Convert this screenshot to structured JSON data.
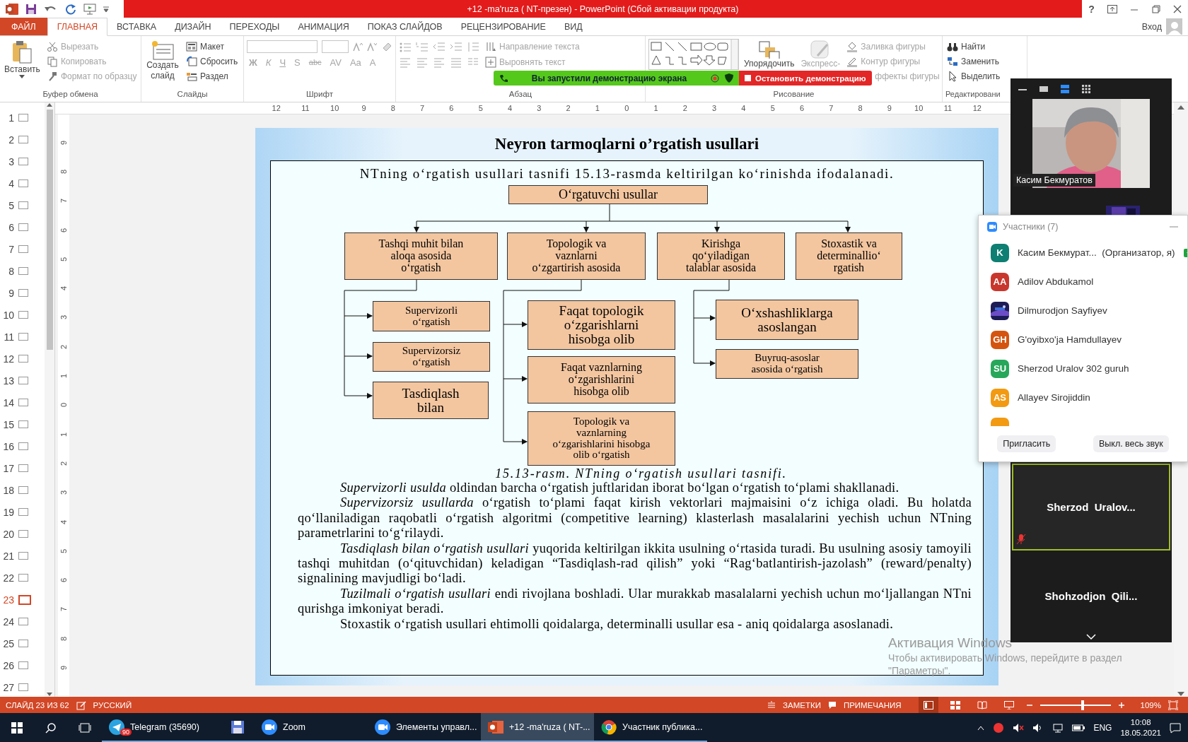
{
  "window": {
    "title": "+12 -ma'ruza ( NT-презен) -  PowerPoint (Сбой активации продукта)",
    "help": "?",
    "account": "Вход"
  },
  "tabs": [
    {
      "label": "ФАЙЛ",
      "kind": "file",
      "selected": false
    },
    {
      "label": "ГЛАВНАЯ",
      "kind": "tab",
      "selected": true
    },
    {
      "label": "ВСТАВКА",
      "kind": "tab",
      "selected": false
    },
    {
      "label": "ДИЗАЙН",
      "kind": "tab",
      "selected": false
    },
    {
      "label": "ПЕРЕХОДЫ",
      "kind": "tab",
      "selected": false
    },
    {
      "label": "АНИМАЦИЯ",
      "kind": "tab",
      "selected": false
    },
    {
      "label": "ПОКАЗ СЛАЙДОВ",
      "kind": "tab",
      "selected": false
    },
    {
      "label": "РЕЦЕНЗИРОВАНИЕ",
      "kind": "tab",
      "selected": false
    },
    {
      "label": "ВИД",
      "kind": "tab",
      "selected": false
    }
  ],
  "ribbon": [
    {
      "kind": "clipboard",
      "label": "Буфер обмена",
      "items": [
        {
          "label": "Вставить",
          "disabled": false
        },
        {
          "label": "Вырезать",
          "disabled": true
        },
        {
          "label": "Копировать",
          "disabled": true
        },
        {
          "label": "Формат по образцу",
          "disabled": true
        }
      ]
    },
    {
      "kind": "slides",
      "label": "Слайды",
      "items": [
        {
          "label": "Создать слайд",
          "disabled": false
        },
        {
          "label": "Макет",
          "disabled": false
        },
        {
          "label": "Сбросить",
          "disabled": false
        },
        {
          "label": "Раздел",
          "disabled": false
        }
      ]
    },
    {
      "kind": "font",
      "label": "Шрифт",
      "items": [
        {
          "label": "Ж",
          "disabled": true
        },
        {
          "label": "К",
          "disabled": true
        },
        {
          "label": "Ч",
          "disabled": true
        },
        {
          "label": "S",
          "disabled": true
        },
        {
          "label": "abc",
          "disabled": true
        },
        {
          "label": "AV",
          "disabled": true
        },
        {
          "label": "Aa",
          "disabled": true
        },
        {
          "label": "A",
          "disabled": true
        }
      ]
    },
    {
      "kind": "paragraph",
      "label": "Абзац",
      "items": [
        {
          "label": "Направление текста",
          "disabled": true
        },
        {
          "label": "Выровнять текст",
          "disabled": true
        }
      ]
    },
    {
      "kind": "drawing",
      "label": "Рисование",
      "items": [
        {
          "label": "Упорядочить",
          "disabled": false
        },
        {
          "label": "Экспресс-",
          "disabled": true
        },
        {
          "label": "Заливка фигуры",
          "disabled": true
        },
        {
          "label": "Контур фигуры",
          "disabled": true
        },
        {
          "label": "ффекты фигуры",
          "disabled": true
        }
      ]
    },
    {
      "kind": "editing",
      "label": "Редактировани",
      "items": [
        {
          "label": "Найти",
          "disabled": false
        },
        {
          "label": "Заменить",
          "disabled": false
        },
        {
          "label": "Выделить",
          "disabled": false
        }
      ]
    }
  ],
  "screen_share": {
    "status": "Вы запустили демонстрацию экрана",
    "stop": "Остановить демонстрацию"
  },
  "ruler": {
    "horizontal": [
      "12",
      "11",
      "10",
      "9",
      "8",
      "7",
      "6",
      "5",
      "4",
      "3",
      "2",
      "1",
      "0",
      "1",
      "2",
      "3",
      "4",
      "5",
      "6",
      "7",
      "8",
      "9",
      "10",
      "11",
      "12"
    ],
    "vertical": [
      "9",
      "8",
      "7",
      "6",
      "5",
      "4",
      "3",
      "2",
      "1",
      "0",
      "1",
      "2",
      "3",
      "4",
      "5",
      "6",
      "7",
      "8",
      "9"
    ]
  },
  "slide_thumbnails": [
    {
      "number": "1",
      "selected": false
    },
    {
      "number": "2",
      "selected": false
    },
    {
      "number": "3",
      "selected": false
    },
    {
      "number": "4",
      "selected": false
    },
    {
      "number": "5",
      "selected": false
    },
    {
      "number": "6",
      "selected": false
    },
    {
      "number": "7",
      "selected": false
    },
    {
      "number": "8",
      "selected": false
    },
    {
      "number": "9",
      "selected": false
    },
    {
      "number": "10",
      "selected": false
    },
    {
      "number": "11",
      "selected": false
    },
    {
      "number": "12",
      "selected": false
    },
    {
      "number": "13",
      "selected": false
    },
    {
      "number": "14",
      "selected": false
    },
    {
      "number": "15",
      "selected": false
    },
    {
      "number": "16",
      "selected": false
    },
    {
      "number": "17",
      "selected": false
    },
    {
      "number": "18",
      "selected": false
    },
    {
      "number": "19",
      "selected": false
    },
    {
      "number": "20",
      "selected": false
    },
    {
      "number": "21",
      "selected": false
    },
    {
      "number": "22",
      "selected": false
    },
    {
      "number": "23",
      "selected": true
    },
    {
      "number": "24",
      "selected": false
    },
    {
      "number": "25",
      "selected": false
    },
    {
      "number": "26",
      "selected": false
    },
    {
      "number": "27",
      "selected": false
    }
  ],
  "slide": {
    "title": "Neyron tarmoqlarni o’rgatish usullari",
    "intro": "NTning o‘rgatish usullari tasnifi 15.13-rasmda keltirilgan ko‘rinishda ifodalanadi.",
    "diagram": {
      "root": "O‘rgatuvchi usullar",
      "branches": [
        {
          "lines": [
            "Tashqi muhit bilan",
            "aloqa asosida",
            "o‘rgatish"
          ],
          "children": [
            {
              "lines": [
                "Supervizorli",
                "o‘rgatish"
              ]
            },
            {
              "lines": [
                "Supervizorsiz",
                "o‘rgatish"
              ]
            },
            {
              "lines": [
                "Tasdiqlash",
                "bilan"
              ]
            }
          ]
        },
        {
          "lines": [
            "Topologik va",
            "vaznlarni",
            "o‘zgartirish asosida"
          ],
          "children": [
            {
              "lines": [
                "Faqat topologik",
                "o‘zgarishlarni",
                "hisobga olib"
              ]
            },
            {
              "lines": [
                "Faqat vaznlarning",
                "o‘zgarishlarini",
                "hisobga olib"
              ]
            },
            {
              "lines": [
                "Topologik va",
                "vaznlarning",
                "o‘zgarishlarini hisobga",
                "olib o‘rgatish"
              ]
            }
          ]
        },
        {
          "lines": [
            "Kirishga",
            "qo‘yiladigan",
            "talablar asosida"
          ],
          "children": [
            {
              "lines": [
                "O‘xshashliklarga",
                "asoslangan"
              ]
            },
            {
              "lines": [
                "Buyruq-asoslar",
                "asosida o‘rgatish"
              ]
            }
          ]
        },
        {
          "lines": [
            "Stoxastik va",
            "determinallio‘",
            "rgatish"
          ]
        }
      ]
    },
    "caption": "15.13-rasm. NTning o‘rgatish usullari tasnifi.",
    "paragraphs": [
      "*Supervizorli usulda* oldindan barcha o‘rgatish juftlaridan iborat bo‘lgan o‘rgatish to‘plami shakllanadi.",
      "*Supervizorsiz usullarda* o‘rgatish to‘plami faqat kirish vektorlari majmaisini o‘z ichiga oladi. Bu holatda qo‘llaniladigan raqobatli o‘rgatish algoritmi (competitive learning) klasterlash masalalarini yechish uchun NTning parametrlarini to‘g‘rilaydi.",
      "*Tasdiqlash bilan o‘rgatish usullari* yuqorida keltirilgan ikkita usulning o‘rtasida turadi. Bu usulning asosiy tamoyili tashqi muhitdan (o‘qituvchidan) keladigan “Tasdiqlash-rad qilish” yoki “Rag‘batlantirish-jazolash” (reward/penalty) signalining mavjudligi bo‘ladi.",
      "*Tuzilmali o‘rgatish usullari* endi rivojlana boshladi. Ular murakkab masalalarni yechish uchun mo‘ljallangan NTni qurishga imkoniyat beradi.",
      "Stoxastik o‘rgatish usullari ehtimolli qoidalarga, determinalli usullar esa - aniq qoidalarga asoslanadi."
    ]
  },
  "zoom_window": {
    "tiles": [
      {
        "kind": "video",
        "name": "Касим Бекмуратов"
      },
      {
        "kind": "video_partial"
      },
      {
        "kind": "name",
        "name": "Sherzod  Uralov...",
        "active": true,
        "muted": true
      },
      {
        "kind": "name",
        "name": "Shohzodjon  Qili...",
        "active": false,
        "muted": false
      }
    ]
  },
  "participants": {
    "title": "Участники (7)",
    "people": [
      {
        "kind": "initials",
        "initials": "K",
        "name": "Касим Бекмурат...",
        "role": "(Организатор, я)",
        "color": "#0e7f72",
        "sharing": true
      },
      {
        "kind": "initials",
        "initials": "AA",
        "name": "Adilov Abdukamol",
        "color": "#c8372d",
        "sharing": false
      },
      {
        "name": "Dilmurodjon Sayfiyev",
        "sharing": false
      },
      {
        "kind": "initials",
        "initials": "GH",
        "name": "G'oyibxo'ja Hamdullayev",
        "color": "#d4540f",
        "sharing": false
      },
      {
        "kind": "initials",
        "initials": "SU",
        "name": "Sherzod Uralov 302 guruh",
        "color": "#27a75a",
        "sharing": false
      },
      {
        "kind": "initials",
        "initials": "AS",
        "name": "Allayev Sirojiddin",
        "color": "#f29a12",
        "sharing": false
      },
      {
        "kind": "clipped",
        "color": "#f29a12",
        "sharing": false
      }
    ],
    "buttons": [
      "Пригласить",
      "Выкл. весь звук"
    ]
  },
  "status_bar": {
    "slide": "СЛАЙД 23 ИЗ 62",
    "language": "РУССКИЙ",
    "notes": "ЗАМЕТКИ",
    "comments": "ПРИМЕЧАНИЯ",
    "zoom": "109%",
    "level": 0.6
  },
  "taskbar": {
    "apps": [
      {
        "kind": "telegram",
        "label": "Telegram (35690)",
        "badge": "90",
        "selected": false
      },
      {
        "kind": "save",
        "selected": false
      },
      {
        "kind": "zoom",
        "label": "Zoom",
        "selected": false
      },
      {
        "kind": "zoom",
        "label": "Элементы управл...",
        "selected": false
      },
      {
        "kind": "powerpoint",
        "label": "+12 -ma'ruza ( NT-...",
        "selected": true
      },
      {
        "kind": "chrome",
        "label": "Участник публика...",
        "selected": false
      }
    ],
    "language": "ENG",
    "time": "10:08",
    "date": "18.05.2021"
  },
  "activation": {
    "title": "Активация Windows",
    "lines": [
      "Чтобы активировать Windows, перейдите в раздел",
      "\"Параметры\"."
    ]
  }
}
